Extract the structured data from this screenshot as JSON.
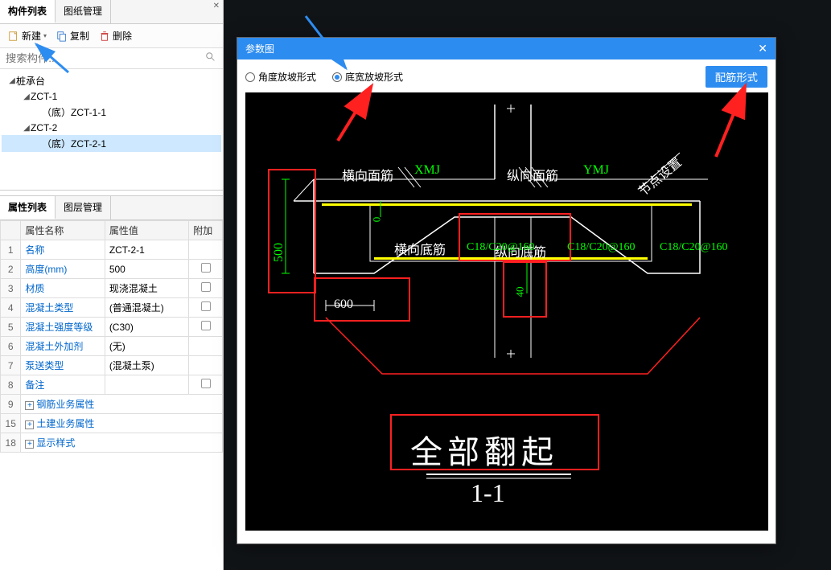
{
  "left": {
    "tabs": {
      "comp": "构件列表",
      "draw": "图纸管理"
    },
    "toolbar": {
      "new": "新建",
      "copy": "复制",
      "del": "删除"
    },
    "search": {
      "placeholder": "搜索构件..."
    },
    "tree": {
      "root": "桩承台",
      "n1": "ZCT-1",
      "n1a": "（底）ZCT-1-1",
      "n2": "ZCT-2",
      "n2a": "（底）ZCT-2-1"
    },
    "propTabs": {
      "prop": "属性列表",
      "layer": "图层管理"
    },
    "propHeader": {
      "name": "属性名称",
      "val": "属性值",
      "extra": "附加"
    },
    "props": [
      {
        "idx": "1",
        "name": "名称",
        "val": "ZCT-2-1",
        "chk": false
      },
      {
        "idx": "2",
        "name": "高度(mm)",
        "val": "500",
        "chk": true
      },
      {
        "idx": "3",
        "name": "材质",
        "val": "现浇混凝土",
        "chk": true
      },
      {
        "idx": "4",
        "name": "混凝土类型",
        "val": "(普通混凝土)",
        "chk": true
      },
      {
        "idx": "5",
        "name": "混凝土强度等级",
        "val": "(C30)",
        "chk": true
      },
      {
        "idx": "6",
        "name": "混凝土外加剂",
        "val": "(无)",
        "chk": false
      },
      {
        "idx": "7",
        "name": "泵送类型",
        "val": "(混凝土泵)",
        "chk": false
      },
      {
        "idx": "8",
        "name": "备注",
        "val": "",
        "chk": true
      }
    ],
    "groups": [
      {
        "idx": "9",
        "name": "钢筋业务属性"
      },
      {
        "idx": "15",
        "name": "土建业务属性"
      },
      {
        "idx": "18",
        "name": "显示样式"
      }
    ]
  },
  "dialog": {
    "title": "参数图",
    "radio1": "角度放坡形式",
    "radio2": "底宽放坡形式",
    "rebarBtn": "配筋形式"
  },
  "drawing": {
    "hx_mj": "横向面筋",
    "xmj": "XMJ",
    "zx_mj": "纵向面筋",
    "ymj": "YMJ",
    "jdSz": "节点设置",
    "hx_dj": "横向底筋",
    "zx_dj": "纵向底筋",
    "rebar1": "C18/C20@160",
    "rebar2": "C18/C20@160",
    "rebar3": "C18/C20@160",
    "d600": "600",
    "d500": "500",
    "d40": "40",
    "d0": "0",
    "title_big": "全部翻起",
    "section": "1-1"
  }
}
